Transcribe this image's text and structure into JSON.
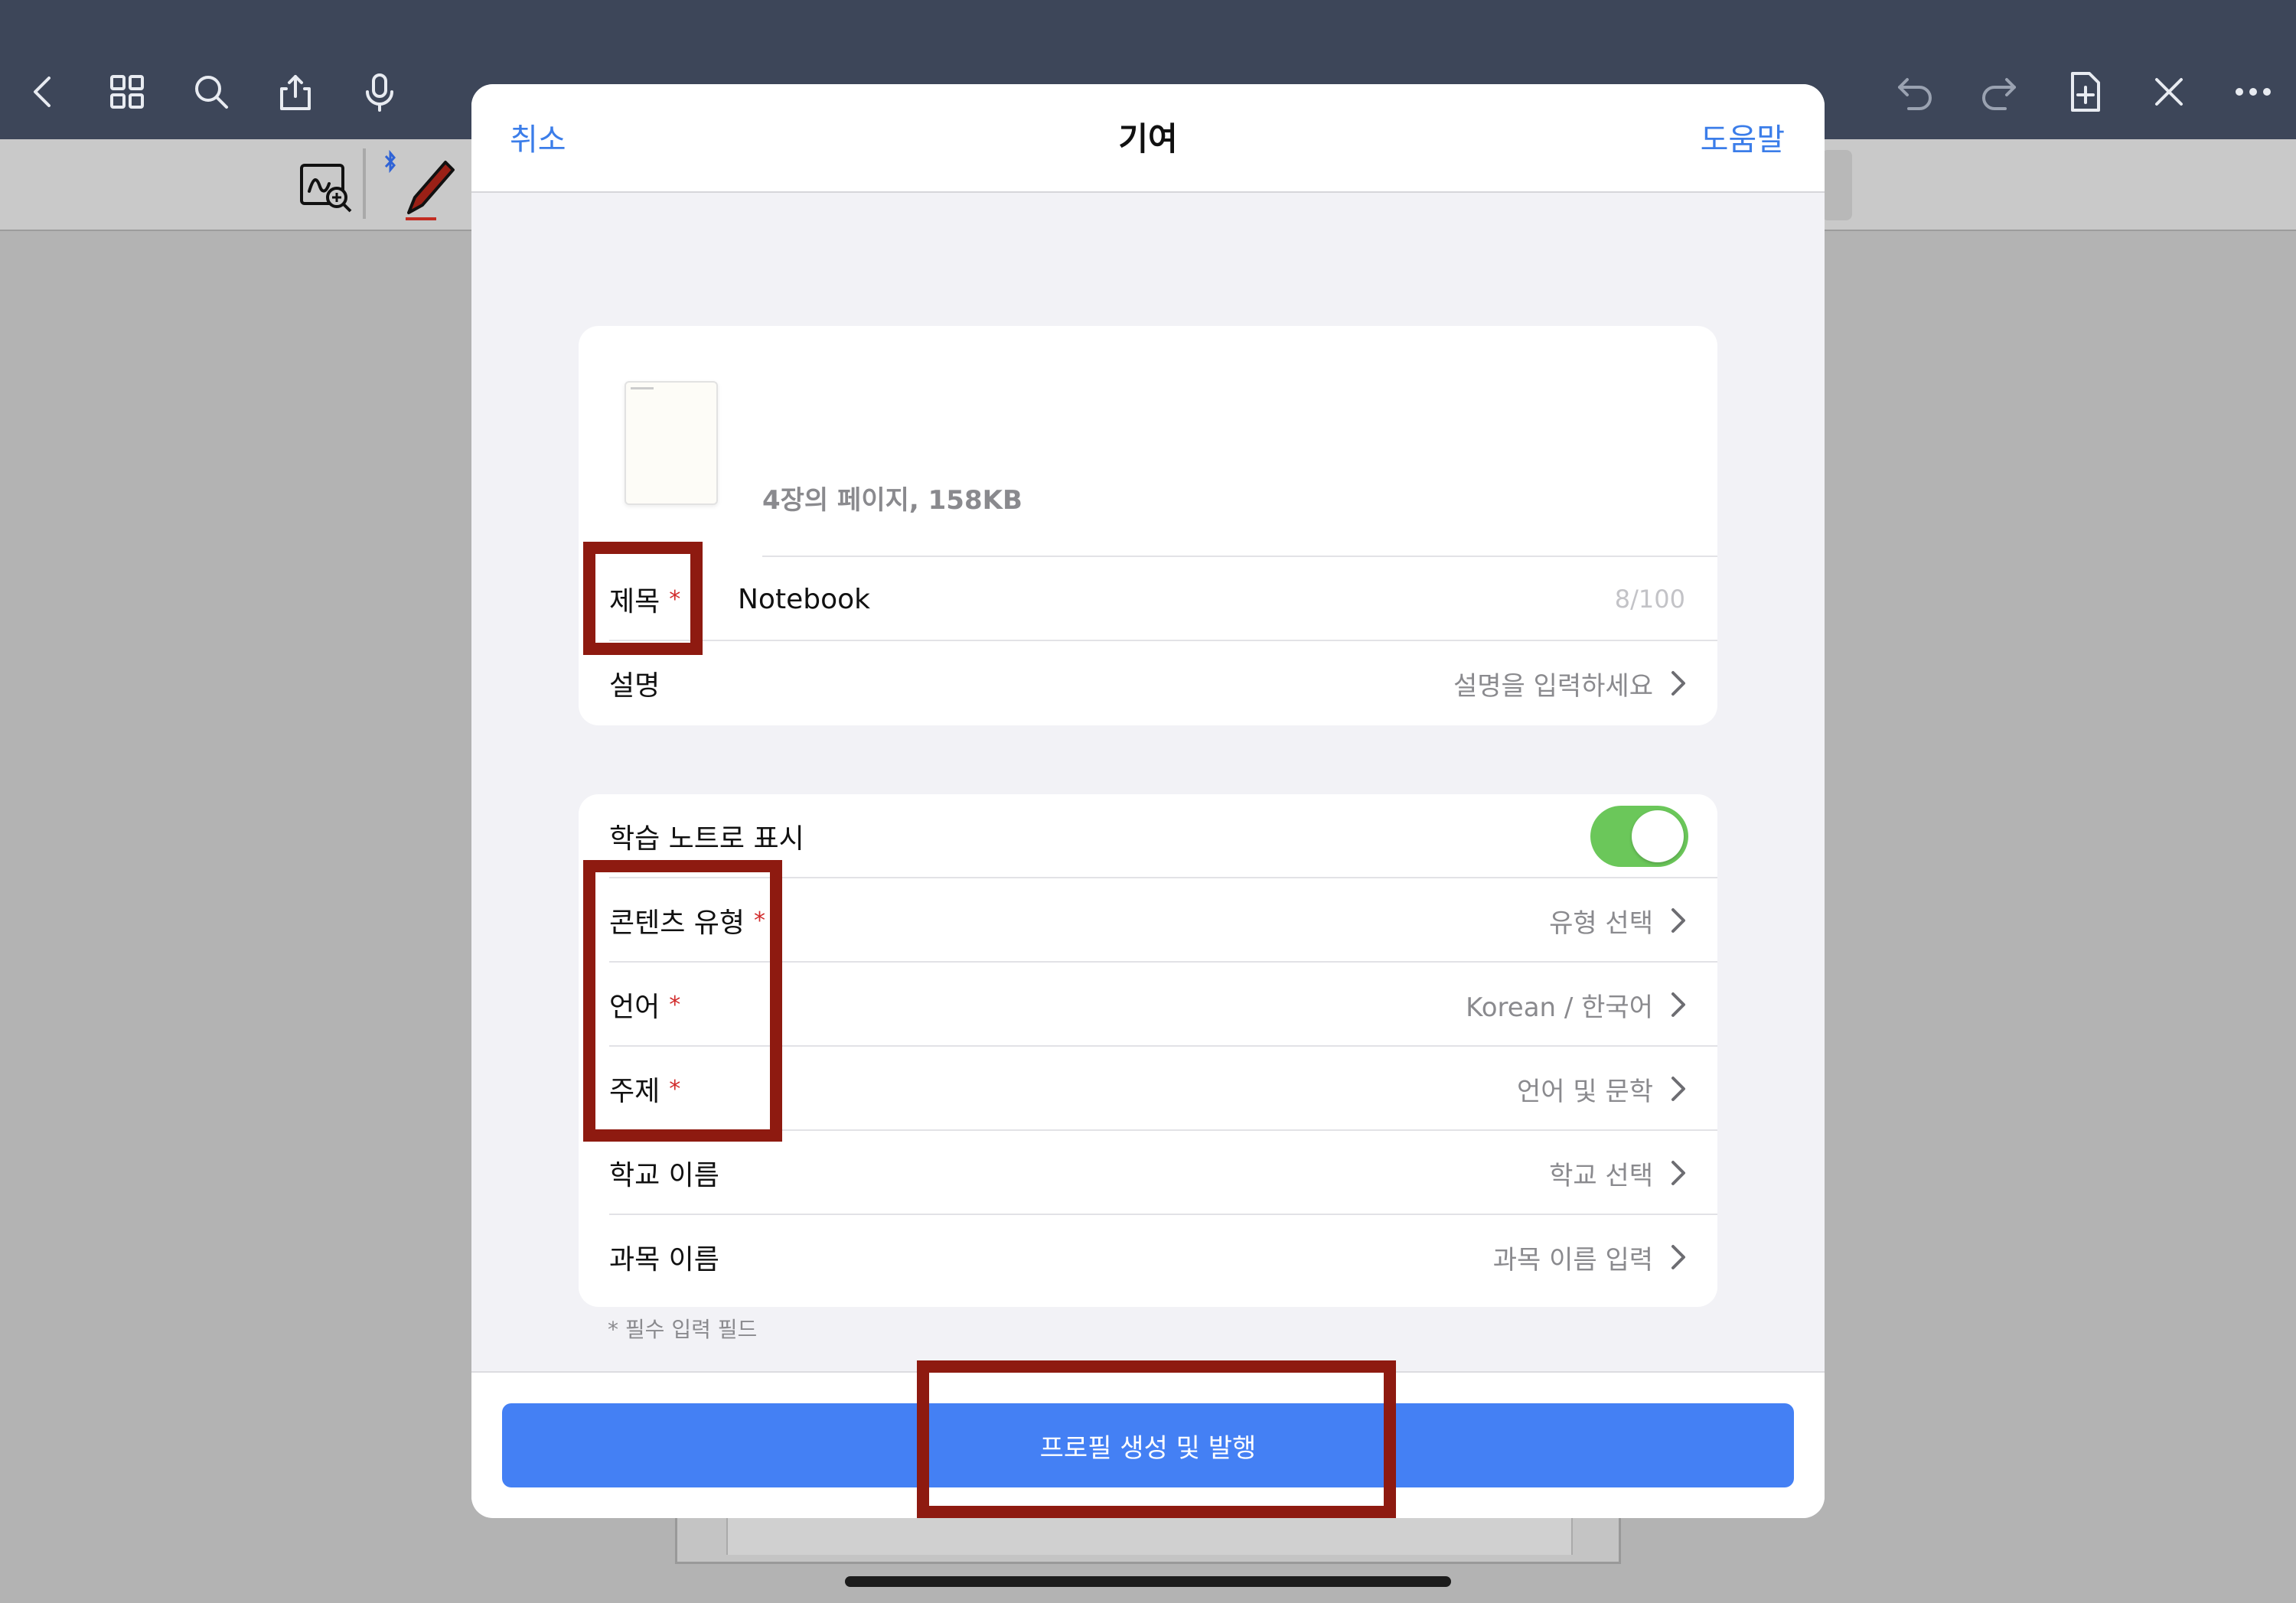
{
  "toolbar": {
    "left_icons": [
      "back-icon",
      "grid-icon",
      "search-icon",
      "share-icon",
      "microphone-icon"
    ],
    "right_icons": [
      "undo-icon",
      "redo-icon",
      "add-page-icon",
      "close-tools-icon",
      "more-icon"
    ]
  },
  "modal": {
    "cancel_label": "취소",
    "title": "기여",
    "help_label": "도움말",
    "file_info": "4장의 페이지, 158KB",
    "title_field": {
      "label": "제목",
      "required_mark": "*",
      "value": "Notebook",
      "counter": "8/100"
    },
    "description": {
      "label": "설명",
      "placeholder": "설명을 입력하세요"
    },
    "study_note": {
      "label": "학습 노트로 표시",
      "enabled": true
    },
    "content_type": {
      "label": "콘텐츠 유형",
      "required_mark": "*",
      "value": "유형 선택"
    },
    "language": {
      "label": "언어",
      "required_mark": "*",
      "value": "Korean / 한국어"
    },
    "subject": {
      "label": "주제",
      "required_mark": "*",
      "value": "언어 및 문학"
    },
    "school_name": {
      "label": "학교 이름",
      "value": "학교 선택"
    },
    "course_name": {
      "label": "과목 이름",
      "value": "과목 이름 입력"
    },
    "required_note": "* 필수 입력 필드",
    "submit_label": "프로필 생성 및 발행"
  },
  "colors": {
    "accent": "#3b7de9",
    "button": "#4480f4",
    "toggle_on": "#6bc75a",
    "required": "#d12b2b",
    "annotation": "#8e1a10"
  }
}
